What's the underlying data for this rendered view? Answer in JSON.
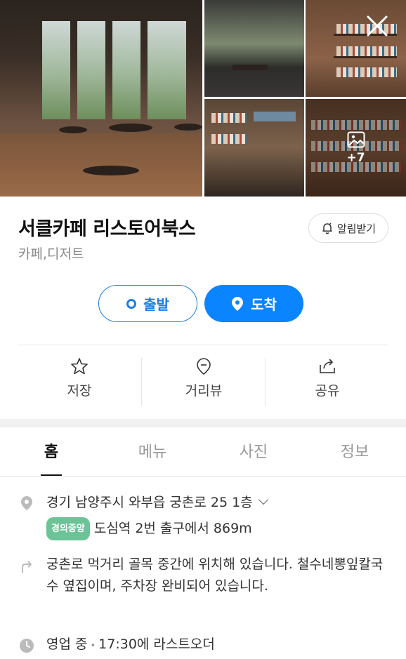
{
  "gallery": {
    "more_count": "+7"
  },
  "place": {
    "name": "서클카페 리스토어북스",
    "category": "카페,디저트",
    "alert_label": "알림받기"
  },
  "route": {
    "depart_label": "출발",
    "arrive_label": "도착"
  },
  "actions": {
    "save_label": "저장",
    "streetview_label": "거리뷰",
    "share_label": "공유"
  },
  "tabs": {
    "home": "홈",
    "menu": "메뉴",
    "photos": "사진",
    "info": "정보"
  },
  "details": {
    "address": "경기 남양주시 와부읍 궁촌로 25 1층",
    "subway_line": "경의중앙",
    "subway_text": "도심역 2번 출구에서 869m",
    "directions": "궁촌로 먹거리 골목 중간에 위치해 있습니다. 철수네뽕잎칼국수 옆집이며, 주차장 완비되어 있습니다.",
    "hours_status": "영업 중",
    "hours_separator": "•",
    "hours_detail": "17:30에 라스트오더"
  },
  "colors": {
    "accent": "#0a84ff",
    "subway_badge": "#6cc397"
  }
}
